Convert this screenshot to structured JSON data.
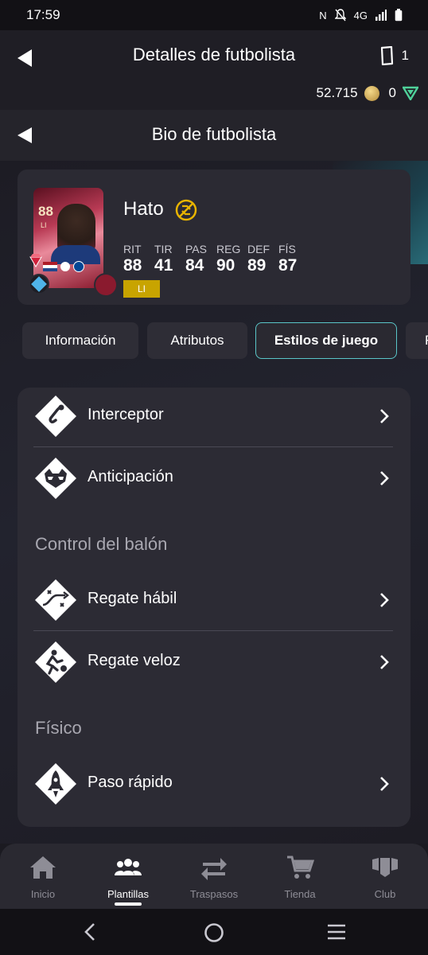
{
  "status": {
    "time": "17:59",
    "network": "4G"
  },
  "header": {
    "title": "Detalles de futbolista",
    "devices_count": "1",
    "coins": "52.715",
    "points": "0"
  },
  "subheader": {
    "title": "Bio de futbolista"
  },
  "player": {
    "name": "Hato",
    "card_rating": "88",
    "card_position": "LI",
    "position_badge": "LI",
    "stats": [
      {
        "label": "RIT",
        "value": "88"
      },
      {
        "label": "TIR",
        "value": "41"
      },
      {
        "label": "PAS",
        "value": "84"
      },
      {
        "label": "REG",
        "value": "90"
      },
      {
        "label": "DEF",
        "value": "89"
      },
      {
        "label": "FÍS",
        "value": "87"
      }
    ]
  },
  "tabs": [
    {
      "label": "Información"
    },
    {
      "label": "Atributos"
    },
    {
      "label": "Estilos de juego",
      "active": true
    },
    {
      "label": "F"
    }
  ],
  "playstyles": {
    "items": [
      {
        "label": "Interceptor",
        "icon": "interceptor-icon"
      },
      {
        "label": "Anticipación",
        "icon": "raccoon-icon"
      }
    ],
    "sections": [
      {
        "title": "Control del balón",
        "items": [
          {
            "label": "Regate hábil",
            "icon": "technical-dribble-icon"
          },
          {
            "label": "Regate veloz",
            "icon": "rapid-dribble-icon"
          }
        ]
      },
      {
        "title": "Físico",
        "items": [
          {
            "label": "Paso rápido",
            "icon": "rocket-icon"
          }
        ]
      }
    ]
  },
  "bottom_nav": [
    {
      "label": "Inicio",
      "icon": "home-icon"
    },
    {
      "label": "Plantillas",
      "icon": "squad-icon",
      "active": true
    },
    {
      "label": "Traspasos",
      "icon": "transfer-icon"
    },
    {
      "label": "Tienda",
      "icon": "cart-icon"
    },
    {
      "label": "Club",
      "icon": "club-icon"
    }
  ],
  "colors": {
    "accent": "#5ac6c8",
    "position_badge": "#c8a400",
    "panel": "#2c2b34"
  }
}
